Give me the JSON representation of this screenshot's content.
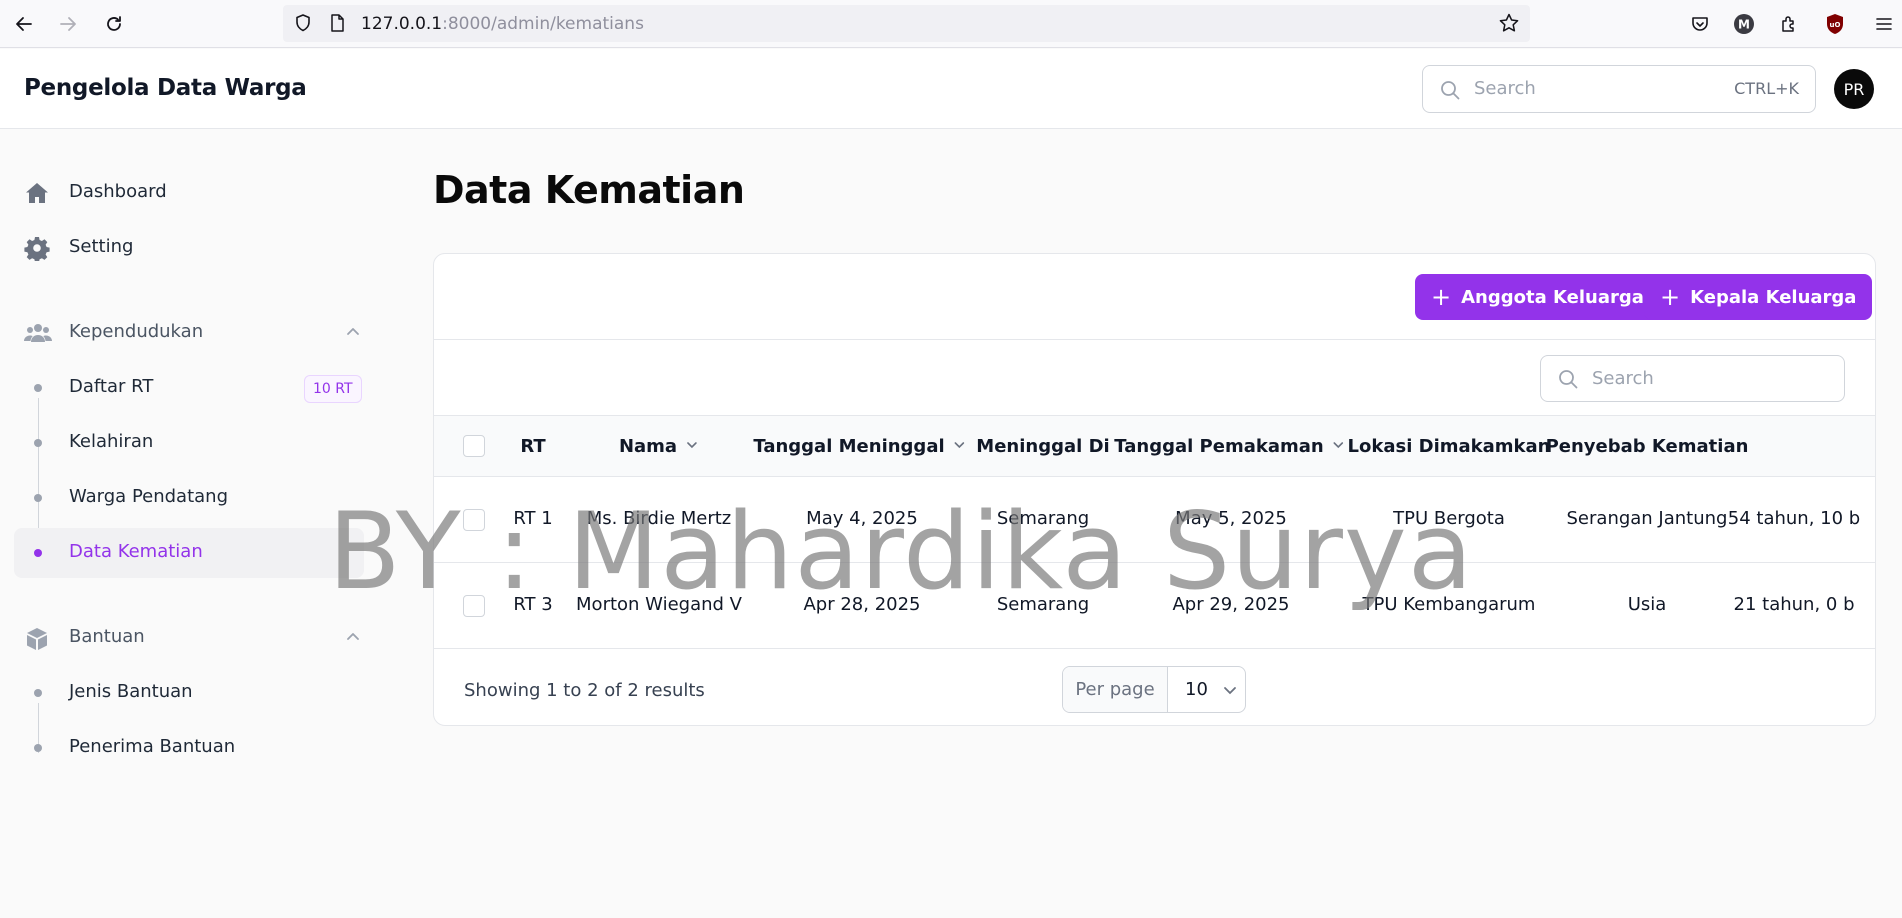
{
  "browser": {
    "url_host": "127.0.0.1",
    "url_path": ":8000/admin/kematians"
  },
  "header": {
    "brand": "Pengelola Data Warga",
    "search_placeholder": "Search",
    "search_shortcut": "CTRL+K",
    "avatar_initials": "PR"
  },
  "sidebar": {
    "top_items": [
      {
        "label": "Dashboard",
        "icon": "home-icon"
      },
      {
        "label": "Setting",
        "icon": "gear-icon"
      }
    ],
    "groups": [
      {
        "label": "Kependudukan",
        "icon": "users-icon",
        "items": [
          {
            "label": "Daftar RT",
            "badge": "10 RT"
          },
          {
            "label": "Kelahiran"
          },
          {
            "label": "Warga Pendatang"
          },
          {
            "label": "Data Kematian",
            "active": true
          }
        ]
      },
      {
        "label": "Bantuan",
        "icon": "cube-icon",
        "items": [
          {
            "label": "Jenis Bantuan"
          },
          {
            "label": "Penerima Bantuan"
          }
        ]
      }
    ]
  },
  "main": {
    "title": "Data Kematian",
    "actions": [
      {
        "label": "Anggota Keluarga"
      },
      {
        "label": "Kepala Keluarga"
      }
    ],
    "table_search_placeholder": "Search",
    "columns": [
      "RT",
      "Nama",
      "Tanggal Meninggal",
      "Meninggal Di",
      "Tanggal Pemakaman",
      "Lokasi Dimakamkan",
      "Penyebab Kematian"
    ],
    "rows": [
      {
        "rt": "RT 1",
        "nama": "Ms. Birdie Mertz",
        "tgl_meninggal": "May 4, 2025",
        "meninggal_di": "Semarang",
        "tgl_pemakaman": "May 5, 2025",
        "lokasi": "TPU Bergota",
        "penyebab": "Serangan Jantung",
        "umur": "54 tahun, 10 b"
      },
      {
        "rt": "RT 3",
        "nama": "Morton Wiegand V",
        "tgl_meninggal": "Apr 28, 2025",
        "meninggal_di": "Semarang",
        "tgl_pemakaman": "Apr 29, 2025",
        "lokasi": "TPU Kembangarum",
        "penyebab": "Usia",
        "umur": "21 tahun, 0 b"
      }
    ],
    "footer_text": "Showing 1 to 2 of 2 results",
    "per_page_label": "Per page",
    "per_page_value": "10"
  },
  "watermark": "BY : Mahardika Surya",
  "colors": {
    "accent": "#9333ea",
    "text": "#111827",
    "border": "#e5e7eb"
  }
}
